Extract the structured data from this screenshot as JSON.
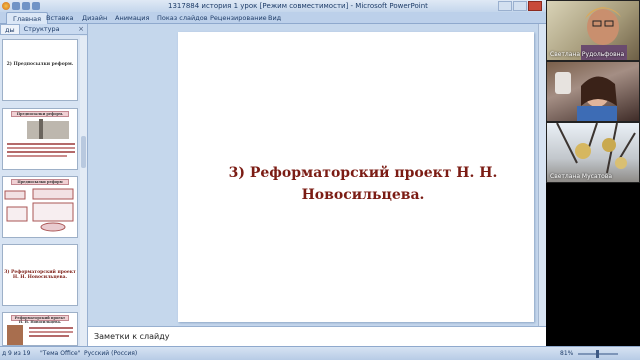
{
  "window": {
    "title": "1317884  история  1 урок [Режим совместимости] - Microsoft PowerPoint"
  },
  "ribbon": {
    "tabs": [
      "Главная",
      "Вставка",
      "Дизайн",
      "Анимация",
      "Показ слайдов",
      "Рецензирование",
      "Вид"
    ]
  },
  "left_panel": {
    "tabs": [
      "ды",
      "Структура"
    ],
    "close": "×",
    "thumbnails": [
      {
        "title": "2) Предпосылки реформ."
      },
      {
        "title": "Предпосылки реформ."
      },
      {
        "title": "Предпосылки реформ"
      },
      {
        "title": "3) Реформаторский проект Н. Н. Новосильцева."
      },
      {
        "title": "Реформаторский проект Н. Н. Новосильцева."
      }
    ]
  },
  "slide": {
    "title_line1": "3) Реформаторский проект Н. Н.",
    "title_line2": "Новосильцева."
  },
  "notes": {
    "placeholder": "Заметки к слайду"
  },
  "status_bar": {
    "slide_info": "д 9 из 19",
    "theme": "\"Тема Office\"",
    "language": "Русский (Россия)",
    "zoom": "81%"
  },
  "participants": [
    {
      "name": "Светлана Рудольфовна"
    },
    {
      "name": ""
    },
    {
      "name": "Светлана Мусатова"
    }
  ],
  "colors": {
    "slide_title": "#7b1c14",
    "accent": "#1e3c68"
  }
}
